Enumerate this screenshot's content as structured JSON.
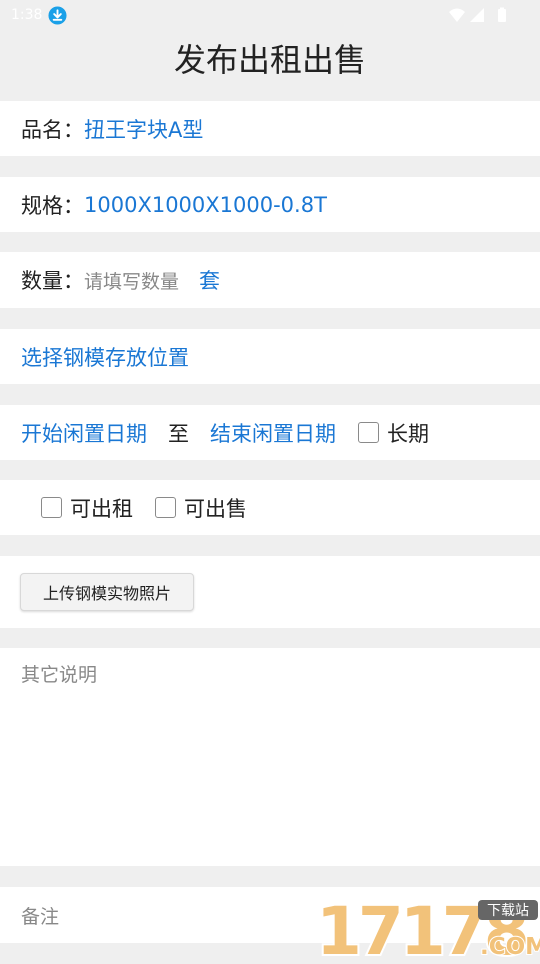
{
  "status": {
    "time": "1:38"
  },
  "header": {
    "title": "发布出租出售"
  },
  "form": {
    "name_label": "品名：",
    "name_value": "扭王字块A型",
    "spec_label": "规格：",
    "spec_value": "1000X1000X1000-0.8T",
    "quantity_label": "数量：",
    "quantity_placeholder": "请填写数量",
    "quantity_unit": "套",
    "location_link": "选择钢模存放位置",
    "start_date": "开始闲置日期",
    "to": "至",
    "end_date": "结束闲置日期",
    "long_term": "长期",
    "rent_option": "可出租",
    "sale_option": "可出售",
    "upload_button": "上传钢模实物照片",
    "other_notes_placeholder": "其它说明",
    "remarks_placeholder": "备注"
  },
  "watermark": {
    "number": "17178",
    "top_text": "下载站",
    "suffix": ".COM"
  },
  "colors": {
    "accent": "#1a77d4",
    "background": "#efefef",
    "hint": "#888888"
  }
}
